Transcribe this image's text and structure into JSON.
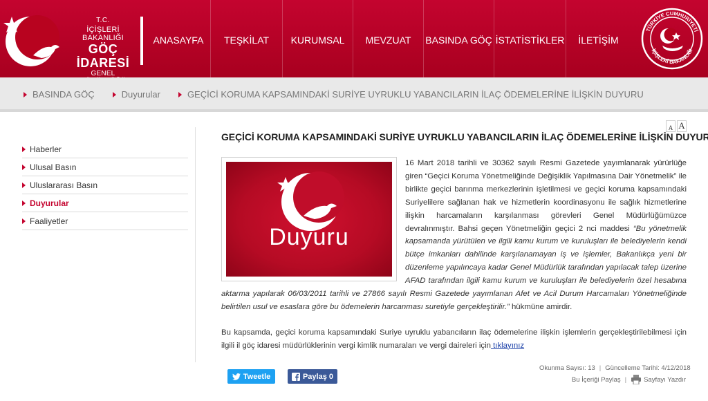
{
  "logo": {
    "tc": "T.C.",
    "ministry": "İÇİŞLERİ BAKANLIĞI",
    "goc": "GÖÇ İDARESİ",
    "gm": "GENEL MÜDÜRLÜĞÜ"
  },
  "nav": {
    "items": [
      {
        "label": "ANASAYFA",
        "width": 92
      },
      {
        "label": "TEŞKİLAT",
        "width": 104
      },
      {
        "label": "KURUMSAL",
        "width": 102
      },
      {
        "label": "MEVZUAT",
        "width": 102
      },
      {
        "label": "BASINDA GÖÇ",
        "width": 102
      },
      {
        "label": "İSTATİSTİKLER",
        "width": 104
      },
      {
        "label": "İLETİŞİM",
        "width": 94
      }
    ]
  },
  "seal": {
    "top_text": "TÜRKİYE CUMHURİYETİ",
    "bottom_text": "İÇİŞLERİ BAKANLIĞI"
  },
  "breadcrumb": [
    "BASINDA GÖÇ",
    "Duyurular",
    "GEÇİCİ KORUMA KAPSAMINDAKİ SURİYE UYRUKLU YABANCILARIN İLAÇ ÖDEMELERİNE İLİŞKİN DUYURU"
  ],
  "sidebar": {
    "items": [
      "Haberler",
      "Ulusal Basın",
      "Uluslararası Basın",
      "Duyurular",
      "Faaliyetler"
    ],
    "active": "Duyurular"
  },
  "font_size": {
    "small": "A",
    "large": "A"
  },
  "article": {
    "title": "GEÇİCİ KORUMA KAPSAMINDAKİ SURİYE UYRUKLU YABANCILARIN İLAÇ ÖDEMELERİNE İLİŞKİN DUYURU",
    "image_caption": "Duyuru",
    "p1_plain": "16 Mart 2018 tarihli ve 30362 sayılı Resmi Gazetede yayımlanarak yürürlüğe giren “Geçici Koruma Yönetmeliğinde Değişiklik Yapılmasına Dair Yönetmelik” ile birlikte geçici barınma merkezlerinin işletilmesi ve geçici koruma kapsamındaki Suriyelilere sağlanan hak ve hizmetlerin koordinasyonu ile sağlık hizmetlerine ilişkin harcamaların karşılanması görevleri Genel Müdürlüğümüzce devralınmıştır. Bahsi geçen Yönetmeliğin geçici 2 nci maddesi ",
    "p1_italic": "“Bu yönetmelik kapsamanda yürütülen ve ilgili kamu kurum ve kuruluşları ile belediyelerin kendi bütçe imkanları dahilinde karşılanamayan iş ve işlemler, Bakanlıkça yeni bir düzenleme yapılıncaya kadar Genel Müdürlük tarafından yapılacak talep üzerine AFAD tarafından ilgili kamu kurum ve kuruluşları ile belediyelerin özel hesabına aktarma yapılarak 06/03/2011 tarihli ve 27866 sayılı Resmi Gazetede yayımlanan Afet ve Acil Durum Harcamaları Yönetmeliğinde belirtilen usul ve esaslara göre bu ödemelerin harcanması suretiyle gerçekleştirilir.”",
    "p1_end": " hükmüne amirdir.",
    "p2_text": "Bu kapsamda, geçici koruma kapsamındaki Suriye uyruklu yabancıların ilaç ödemelerine ilişkin işlemlerin gerçekleştirilebilmesi için ilgili il göç idaresi müdürlüklerinin vergi kimlik numaraları ve vergi daireleri için",
    "p2_link": " tıklayınız"
  },
  "share": {
    "tweet_label": "Tweetle",
    "fb_label": "Paylaş 0"
  },
  "meta": {
    "reads": "Okunma Sayısı: 13",
    "updated": "Güncelleme Tarihi: 4/12/2018",
    "share_content": "Bu İçeriği Paylaş",
    "print": "Sayfayı Yazdır"
  }
}
